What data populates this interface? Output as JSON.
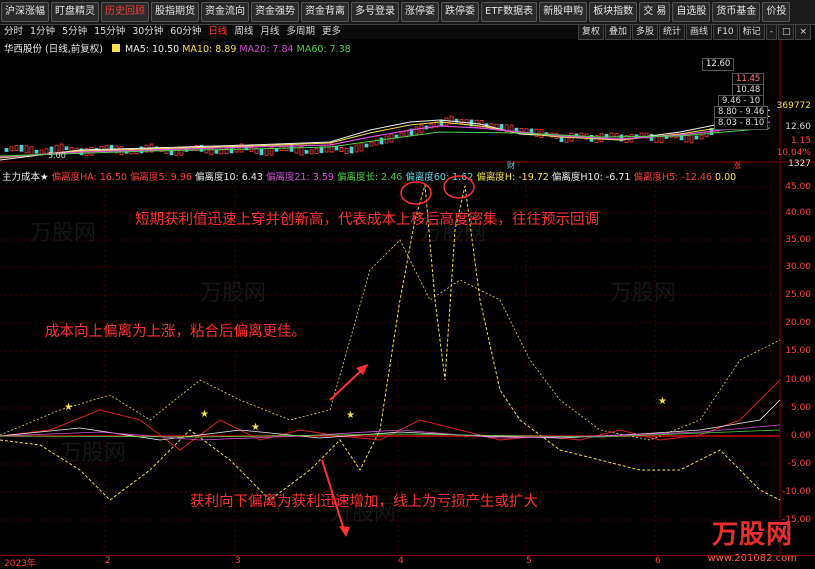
{
  "nav": [
    "沪深涨幅",
    "盯盘精灵",
    "历史回顾",
    "股指期货",
    "资金流向",
    "资金强势",
    "资金背离",
    "多号登录",
    "涨停委",
    "跌停委",
    "ETF数据表",
    "新股申购",
    "板块指数",
    "交 易",
    "自选股",
    "货币基金",
    "价投"
  ],
  "nav_active": 2,
  "periods": [
    "分时",
    "1分钟",
    "5分钟",
    "15分钟",
    "30分钟",
    "60分钟",
    "日线",
    "周线",
    "月线",
    "多周期",
    "更多"
  ],
  "period_active": 6,
  "tools": [
    "复权",
    "叠加",
    "多股",
    "统计",
    "画线",
    "F10",
    "标记",
    "-",
    "□",
    "×"
  ],
  "main_header": {
    "stock": "华西股份 (日线,前复权)",
    "ma5": "MA5: 10.50",
    "ma10": "MA10: 8.89",
    "ma20": "MA20: 7.84",
    "ma60": "MA60: 7.38"
  },
  "main_price_labels": [
    "12.60",
    "11.45",
    "10.48",
    "9.46 - 10",
    "8.80 - 9.46",
    "8.03 - 8.10",
    "369772",
    "12.60",
    "1.15",
    "10.04%",
    "1327"
  ],
  "main_low_label": "5.00",
  "main_marks": [
    "财",
    "涨"
  ],
  "indicator_header": {
    "name": "主力成本★",
    "ha": "偏离度HA: 16.50",
    "d5": "偏离度5: 9.96",
    "d10": "偏离度10: 6.43",
    "d21": "偏离度21: 3.59",
    "dlong": "偏离度长: 2.46",
    "d60": "偏离度60: 1.62",
    "dh": "偏离度H: -19.72",
    "dh10": "偏离度H10: -6.71",
    "dh5": "偏离度H5: -12.46",
    "zero": "0.00"
  },
  "y_axis_labels": [
    "45.00",
    "40.00",
    "35.00",
    "30.00",
    "25.00",
    "20.00",
    "15.00",
    "10.00",
    "5.00",
    "0.00",
    "-5.00",
    "-10.00",
    "-15.00"
  ],
  "x_axis_labels": [
    "2023年",
    "2",
    "3",
    "4",
    "5",
    "6"
  ],
  "annotations": {
    "a1": "短期获利值迅速上穿并创新高，代表成本上移后高度密集，往往预示回调",
    "a2": "成本向上偏离为上涨，粘合后偏离更佳。",
    "a3": "获利向下偏离为获利迅速增加，线上为亏损产生或扩大"
  },
  "watermark": {
    "brand": "万股网",
    "url": "www.201082.com"
  },
  "colors": {
    "red": "#ff3b3b",
    "yellow": "#f2e14b",
    "magenta": "#d84fd8",
    "green": "#4cd24c",
    "cyan": "#66d9e8"
  }
}
